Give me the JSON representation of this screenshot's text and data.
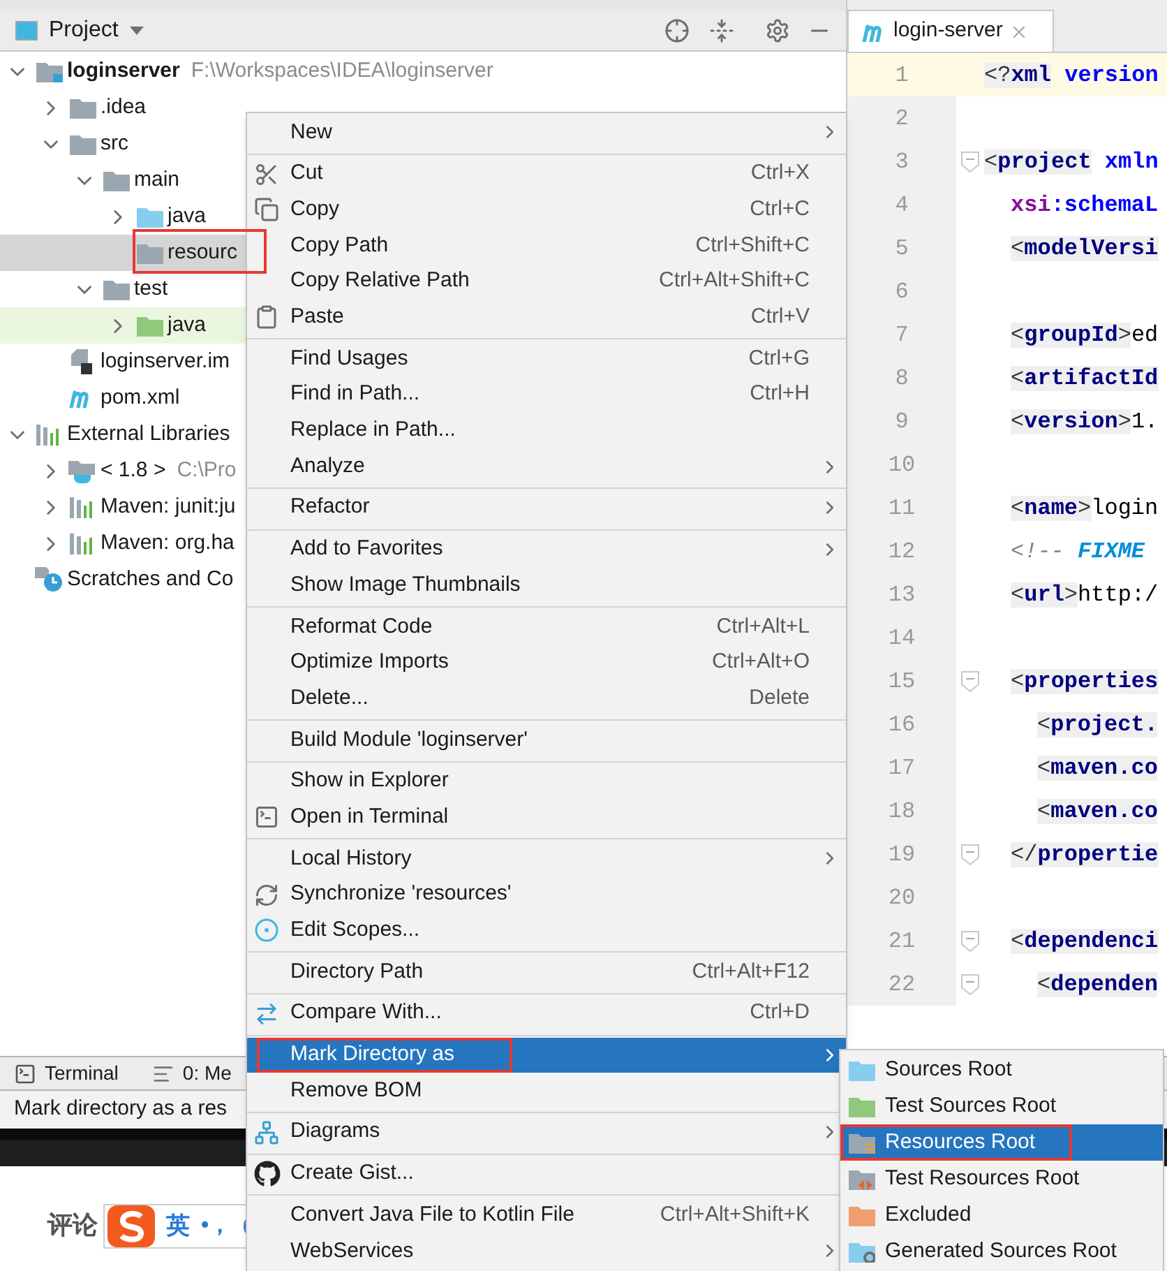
{
  "project_panel": {
    "title": "Project",
    "tree": [
      {
        "label": "loginserver",
        "path": "F:\\Workspaces\\IDEA\\loginserver",
        "kind": "module",
        "expanded": true,
        "selected": false,
        "children": [
          {
            "label": ".idea",
            "kind": "folder",
            "expanded": false,
            "selected": false
          },
          {
            "label": "src",
            "kind": "folder",
            "expanded": true,
            "selected": false,
            "children": [
              {
                "label": "main",
                "kind": "folder",
                "expanded": true,
                "selected": false,
                "children": [
                  {
                    "label": "java",
                    "kind": "source",
                    "expanded": false,
                    "selected": false
                  },
                  {
                    "label": "resourc",
                    "kind": "folder",
                    "selected": true,
                    "annotated": true
                  }
                ]
              },
              {
                "label": "test",
                "kind": "folder",
                "expanded": true,
                "selected": false,
                "children": [
                  {
                    "label": "java",
                    "kind": "test-source",
                    "expanded": false,
                    "selected": false
                  }
                ]
              }
            ]
          },
          {
            "label": "loginserver.im",
            "kind": "iml",
            "selected": false
          },
          {
            "label": "pom.xml",
            "kind": "maven",
            "selected": false
          }
        ]
      },
      {
        "label": "External Libraries",
        "kind": "libraries",
        "expanded": true,
        "selected": false,
        "children": [
          {
            "label": "< 1.8 >",
            "path": "C:\\Pro",
            "kind": "sdk",
            "expanded": false,
            "selected": false
          },
          {
            "label": "Maven: junit:ju",
            "kind": "library",
            "expanded": false,
            "selected": false
          },
          {
            "label": "Maven: org.ha",
            "kind": "library",
            "expanded": false,
            "selected": false
          }
        ]
      },
      {
        "label": "Scratches and Co",
        "kind": "scratches",
        "selected": false
      }
    ]
  },
  "editor": {
    "tab": {
      "title": "login-server"
    },
    "lines": [
      {
        "number": "1",
        "current": true,
        "tokens": [
          {
            "kind": "punct",
            "text": "<?"
          },
          {
            "kind": "tag",
            "text": "xml"
          },
          {
            "kind": "attr",
            "text": " version"
          }
        ]
      },
      {
        "number": "2",
        "current": false
      },
      {
        "number": "3",
        "current": false,
        "fold": true,
        "tokens": [
          {
            "kind": "punct",
            "text": "<"
          },
          {
            "kind": "tag",
            "text": "project"
          },
          {
            "kind": "attr",
            "text": " xmln"
          }
        ],
        "children": [
          {
            "number": "4",
            "current": false,
            "tokens": [
              {
                "kind": "ns",
                "text": "xsi"
              },
              {
                "kind": "attr",
                "text": ":schemaL"
              }
            ]
          },
          {
            "number": "5",
            "current": false,
            "tokens": [
              {
                "kind": "punct",
                "text": "<"
              },
              {
                "kind": "tag",
                "text": "modelVersi"
              }
            ]
          },
          {
            "number": "6",
            "current": false
          },
          {
            "number": "7",
            "current": false,
            "tokens": [
              {
                "kind": "punct",
                "text": "<"
              },
              {
                "kind": "tag",
                "text": "groupId"
              },
              {
                "kind": "punct",
                "text": ">"
              },
              {
                "kind": "text",
                "text": "ed"
              }
            ]
          },
          {
            "number": "8",
            "current": false,
            "tokens": [
              {
                "kind": "punct",
                "text": "<"
              },
              {
                "kind": "tag",
                "text": "artifactId"
              }
            ]
          },
          {
            "number": "9",
            "current": false,
            "tokens": [
              {
                "kind": "punct",
                "text": "<"
              },
              {
                "kind": "tag",
                "text": "version"
              },
              {
                "kind": "punct",
                "text": ">"
              },
              {
                "kind": "text",
                "text": "1."
              }
            ]
          },
          {
            "number": "10",
            "current": false
          },
          {
            "number": "11",
            "current": false,
            "tokens": [
              {
                "kind": "punct",
                "text": "<"
              },
              {
                "kind": "tag",
                "text": "name"
              },
              {
                "kind": "punct",
                "text": ">"
              },
              {
                "kind": "text",
                "text": "login"
              }
            ]
          },
          {
            "number": "12",
            "current": false,
            "tokens": [
              {
                "kind": "comment",
                "text": "<!-- "
              },
              {
                "kind": "todo",
                "text": "FIXME"
              }
            ]
          },
          {
            "number": "13",
            "current": false,
            "tokens": [
              {
                "kind": "punct",
                "text": "<"
              },
              {
                "kind": "tag",
                "text": "url"
              },
              {
                "kind": "punct",
                "text": ">"
              },
              {
                "kind": "text",
                "text": "http:/"
              }
            ]
          },
          {
            "number": "14",
            "current": false
          },
          {
            "number": "15",
            "current": false,
            "fold": true,
            "tokens": [
              {
                "kind": "punct",
                "text": "<"
              },
              {
                "kind": "tag",
                "text": "properties"
              }
            ],
            "children": [
              {
                "number": "16",
                "current": false,
                "tokens": [
                  {
                    "kind": "punct",
                    "text": "<"
                  },
                  {
                    "kind": "tag",
                    "text": "project."
                  }
                ]
              },
              {
                "number": "17",
                "current": false,
                "tokens": [
                  {
                    "kind": "punct",
                    "text": "<"
                  },
                  {
                    "kind": "tag",
                    "text": "maven.co"
                  }
                ]
              },
              {
                "number": "18",
                "current": false,
                "tokens": [
                  {
                    "kind": "punct",
                    "text": "<"
                  },
                  {
                    "kind": "tag",
                    "text": "maven.co"
                  }
                ]
              }
            ]
          },
          {
            "number": "19",
            "current": false,
            "fold": true,
            "tokens": [
              {
                "kind": "punct",
                "text": "</"
              },
              {
                "kind": "tag",
                "text": "propertie"
              }
            ]
          },
          {
            "number": "20",
            "current": false
          },
          {
            "number": "21",
            "current": false,
            "fold": true,
            "tokens": [
              {
                "kind": "punct",
                "text": "<"
              },
              {
                "kind": "tag",
                "text": "dependenci"
              }
            ],
            "children": [
              {
                "number": "22",
                "current": false,
                "fold": true,
                "tokens": [
                  {
                    "kind": "punct",
                    "text": "<"
                  },
                  {
                    "kind": "tag",
                    "text": "dependen"
                  }
                ]
              }
            ]
          }
        ]
      }
    ]
  },
  "tool_tabs": [
    "Terminal",
    "0: Me"
  ],
  "status_bar": "Mark directory as a res",
  "comment_bar": {
    "label": "评论",
    "ime_mode": "英",
    "ime_punct": "•，"
  },
  "context_menu": {
    "groups": [
      {
        "items": [
          {
            "label": "New",
            "submenu": true,
            "selected": false
          }
        ]
      },
      {
        "items": [
          {
            "label": "Cut",
            "shortcut": "Ctrl+X",
            "selected": false
          },
          {
            "label": "Copy",
            "shortcut": "Ctrl+C",
            "selected": false
          },
          {
            "label": "Copy Path",
            "shortcut": "Ctrl+Shift+C",
            "selected": false
          },
          {
            "label": "Copy Relative Path",
            "shortcut": "Ctrl+Alt+Shift+C",
            "selected": false
          },
          {
            "label": "Paste",
            "shortcut": "Ctrl+V",
            "selected": false
          }
        ]
      },
      {
        "items": [
          {
            "label": "Find Usages",
            "shortcut": "Ctrl+G",
            "selected": false
          },
          {
            "label": "Find in Path...",
            "shortcut": "Ctrl+H",
            "selected": false
          },
          {
            "label": "Replace in Path...",
            "selected": false
          },
          {
            "label": "Analyze",
            "submenu": true,
            "selected": false
          }
        ]
      },
      {
        "items": [
          {
            "label": "Refactor",
            "submenu": true,
            "selected": false
          }
        ]
      },
      {
        "items": [
          {
            "label": "Add to Favorites",
            "submenu": true,
            "selected": false
          },
          {
            "label": "Show Image Thumbnails",
            "selected": false
          }
        ]
      },
      {
        "items": [
          {
            "label": "Reformat Code",
            "shortcut": "Ctrl+Alt+L",
            "selected": false
          },
          {
            "label": "Optimize Imports",
            "shortcut": "Ctrl+Alt+O",
            "selected": false
          },
          {
            "label": "Delete...",
            "shortcut": "Delete",
            "selected": false
          }
        ]
      },
      {
        "items": [
          {
            "label": "Build Module 'loginserver'",
            "selected": false
          }
        ]
      },
      {
        "items": [
          {
            "label": "Show in Explorer",
            "selected": false
          },
          {
            "label": "Open in Terminal",
            "selected": false
          }
        ]
      },
      {
        "items": [
          {
            "label": "Local History",
            "submenu": true,
            "selected": false
          },
          {
            "label": "Synchronize 'resources'",
            "selected": false
          },
          {
            "label": "Edit Scopes...",
            "selected": false
          }
        ]
      },
      {
        "items": [
          {
            "label": "Directory Path",
            "shortcut": "Ctrl+Alt+F12",
            "selected": false
          }
        ]
      },
      {
        "items": [
          {
            "label": "Compare With...",
            "shortcut": "Ctrl+D",
            "selected": false
          }
        ]
      },
      {
        "items": [
          {
            "label": "Mark Directory as",
            "submenu": true,
            "selected": true,
            "annotated": true
          },
          {
            "label": "Remove BOM",
            "selected": false
          }
        ]
      },
      {
        "items": [
          {
            "label": "Diagrams",
            "submenu": true,
            "selected": false
          }
        ]
      },
      {
        "items": [
          {
            "label": "Create Gist...",
            "selected": false
          }
        ]
      },
      {
        "items": [
          {
            "label": "Convert Java File to Kotlin File",
            "shortcut": "Ctrl+Alt+Shift+K",
            "selected": false
          },
          {
            "label": "WebServices",
            "submenu": true,
            "selected": false
          }
        ]
      }
    ]
  },
  "submenu": {
    "items": [
      {
        "label": "Sources Root",
        "kind": "source",
        "selected": false
      },
      {
        "label": "Test Sources Root",
        "kind": "test-source",
        "selected": false
      },
      {
        "label": "Resources Root",
        "kind": "resources",
        "selected": true,
        "annotated": true
      },
      {
        "label": "Test Resources Root",
        "kind": "test-resources",
        "selected": false
      },
      {
        "label": "Excluded",
        "kind": "excluded",
        "selected": false
      },
      {
        "label": "Generated Sources Root",
        "kind": "generated",
        "selected": false
      }
    ]
  }
}
